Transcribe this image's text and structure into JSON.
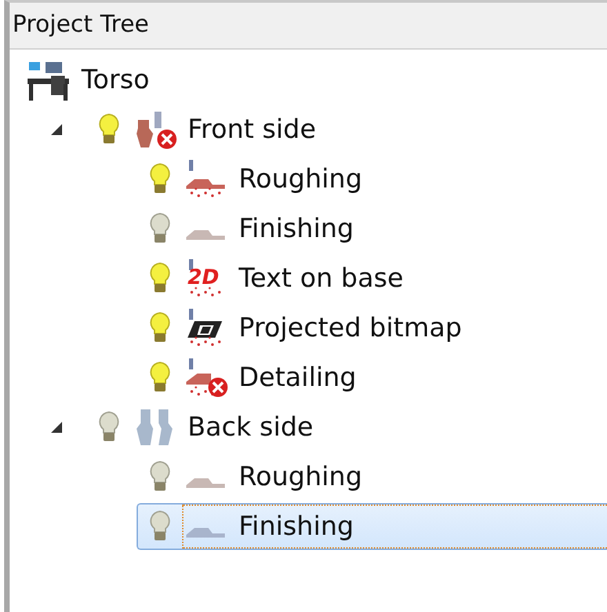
{
  "panel": {
    "title": "Project Tree"
  },
  "tree": [
    {
      "label": "Torso",
      "kind": "machine",
      "selected": false,
      "children": [
        {
          "label": "Front side",
          "kind": "side-front",
          "error": true,
          "lit": true,
          "expanded": true,
          "selected": false,
          "children": [
            {
              "label": "Roughing",
              "kind": "roughing",
              "lit": true,
              "computed": true,
              "error": false,
              "selected": false
            },
            {
              "label": "Finishing",
              "kind": "finishing",
              "lit": false,
              "computed": false,
              "error": false,
              "selected": false
            },
            {
              "label": "Text on base",
              "kind": "text",
              "icon_text": "2D",
              "lit": true,
              "computed": true,
              "error": false,
              "selected": false
            },
            {
              "label": "Projected bitmap",
              "kind": "bitmap",
              "lit": true,
              "computed": true,
              "error": false,
              "selected": false
            },
            {
              "label": "Detailing",
              "kind": "detailing",
              "lit": true,
              "computed": true,
              "error": true,
              "selected": false
            }
          ]
        },
        {
          "label": "Back side",
          "kind": "side-back",
          "error": false,
          "lit": false,
          "expanded": true,
          "selected": false,
          "children": [
            {
              "label": "Roughing",
              "kind": "roughing",
              "lit": false,
              "computed": false,
              "error": false,
              "selected": false
            },
            {
              "label": "Finishing",
              "kind": "finishing",
              "lit": false,
              "computed": false,
              "error": false,
              "selected": true
            }
          ]
        }
      ]
    }
  ]
}
